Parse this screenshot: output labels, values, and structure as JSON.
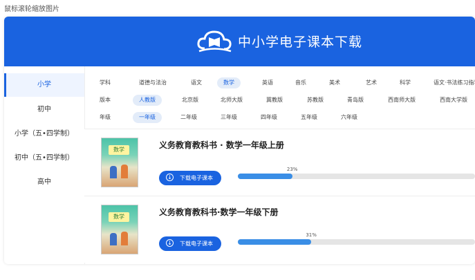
{
  "hint": "鼠标滚轮缩放图片",
  "banner": {
    "title": "中小学电子课本下载"
  },
  "sidebar": {
    "items": [
      {
        "label": "小学",
        "active": true
      },
      {
        "label": "初中",
        "active": false
      },
      {
        "label": "小学（五•四学制）",
        "active": false
      },
      {
        "label": "初中（五•四学制）",
        "active": false
      },
      {
        "label": "高中",
        "active": false
      }
    ]
  },
  "filters": {
    "subject": {
      "label": "学科",
      "options": [
        "道德与法治",
        "语文",
        "数学",
        "英语",
        "音乐",
        "美术",
        "艺术",
        "科学",
        "语文·书法练习指导"
      ],
      "selected": "数学"
    },
    "edition": {
      "label": "版本",
      "options": [
        "人教版",
        "北京版",
        "北师大版",
        "冀教版",
        "苏教版",
        "青岛版",
        "西南师大版",
        "西南大学版"
      ],
      "selected": "人教版"
    },
    "grade": {
      "label": "年级",
      "options": [
        "一年级",
        "二年级",
        "三年级",
        "四年级",
        "五年级",
        "六年级"
      ],
      "selected": "一年级"
    }
  },
  "books": [
    {
      "title": "义务教育教科书 · 数学一年级上册",
      "cover_text": "数学",
      "button": "下载电子课本",
      "progress_pct": 23,
      "progress_label": "23%"
    },
    {
      "title": "义务教育教科书·数学一年级下册",
      "cover_text": "数学",
      "button": "下载电子课本",
      "progress_pct": 31,
      "progress_label": "31%"
    }
  ],
  "colors": {
    "accent": "#1a63e0",
    "progress": "#3a8ee6",
    "chip_selected": "#e3ecf9"
  }
}
